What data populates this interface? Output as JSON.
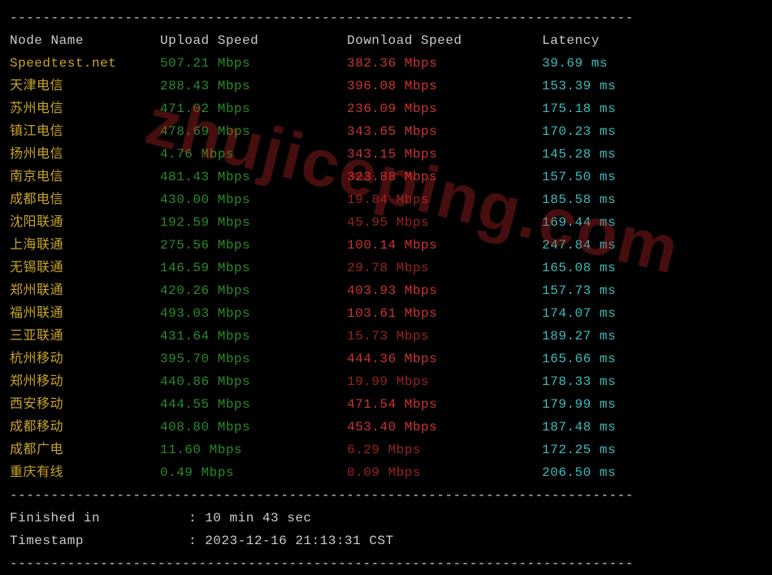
{
  "watermark": "zhujiceping.com",
  "divider": "----------------------------------------------------------------------------",
  "headers": {
    "node": "Node Name",
    "upload": "Upload Speed",
    "download": "Download Speed",
    "latency": "Latency"
  },
  "rows": [
    {
      "node": "Speedtest.net",
      "upload": "507.21 Mbps",
      "download": "382.36 Mbps",
      "latency": "39.69 ms",
      "nodeClass": "yellow",
      "uploadClass": "green",
      "downloadClass": "red",
      "latencyClass": "cyan"
    },
    {
      "node": "天津电信",
      "upload": "288.43 Mbps",
      "download": "396.08 Mbps",
      "latency": "153.39 ms",
      "nodeClass": "yellow",
      "uploadClass": "green",
      "downloadClass": "red",
      "latencyClass": "cyan"
    },
    {
      "node": "苏州电信",
      "upload": "471.02 Mbps",
      "download": "236.09 Mbps",
      "latency": "175.18 ms",
      "nodeClass": "yellow",
      "uploadClass": "green",
      "downloadClass": "red",
      "latencyClass": "cyan"
    },
    {
      "node": "镇江电信",
      "upload": "478.69 Mbps",
      "download": "343.65 Mbps",
      "latency": "170.23 ms",
      "nodeClass": "yellow",
      "uploadClass": "green",
      "downloadClass": "red",
      "latencyClass": "cyan"
    },
    {
      "node": "扬州电信",
      "upload": "4.76 Mbps",
      "download": "343.15 Mbps",
      "latency": "145.28 ms",
      "nodeClass": "yellow",
      "uploadClass": "green",
      "downloadClass": "red",
      "latencyClass": "cyan"
    },
    {
      "node": "南京电信",
      "upload": "481.43 Mbps",
      "download": "323.88 Mbps",
      "latency": "157.50 ms",
      "nodeClass": "yellow",
      "uploadClass": "green",
      "downloadClass": "red",
      "latencyClass": "cyan"
    },
    {
      "node": "成都电信",
      "upload": "430.00 Mbps",
      "download": "19.84 Mbps",
      "latency": "185.58 ms",
      "nodeClass": "yellow",
      "uploadClass": "green",
      "downloadClass": "darkred",
      "latencyClass": "cyan"
    },
    {
      "node": "沈阳联通",
      "upload": "192.59 Mbps",
      "download": "45.95 Mbps",
      "latency": "169.44 ms",
      "nodeClass": "yellow",
      "uploadClass": "green",
      "downloadClass": "darkred",
      "latencyClass": "cyan"
    },
    {
      "node": "上海联通",
      "upload": "275.56 Mbps",
      "download": "100.14 Mbps",
      "latency": "247.84 ms",
      "nodeClass": "yellow",
      "uploadClass": "green",
      "downloadClass": "red",
      "latencyClass": "cyan"
    },
    {
      "node": "无锡联通",
      "upload": "146.59 Mbps",
      "download": "29.78 Mbps",
      "latency": "165.08 ms",
      "nodeClass": "yellow",
      "uploadClass": "green",
      "downloadClass": "darkred",
      "latencyClass": "cyan"
    },
    {
      "node": "郑州联通",
      "upload": "420.26 Mbps",
      "download": "403.93 Mbps",
      "latency": "157.73 ms",
      "nodeClass": "yellow",
      "uploadClass": "green",
      "downloadClass": "red",
      "latencyClass": "cyan"
    },
    {
      "node": "福州联通",
      "upload": "493.03 Mbps",
      "download": "103.61 Mbps",
      "latency": "174.07 ms",
      "nodeClass": "yellow",
      "uploadClass": "green",
      "downloadClass": "red",
      "latencyClass": "cyan"
    },
    {
      "node": "三亚联通",
      "upload": "431.64 Mbps",
      "download": "15.73 Mbps",
      "latency": "189.27 ms",
      "nodeClass": "yellow",
      "uploadClass": "green",
      "downloadClass": "darkred",
      "latencyClass": "cyan"
    },
    {
      "node": "杭州移动",
      "upload": "395.70 Mbps",
      "download": "444.36 Mbps",
      "latency": "165.66 ms",
      "nodeClass": "yellow",
      "uploadClass": "green",
      "downloadClass": "red",
      "latencyClass": "cyan"
    },
    {
      "node": "郑州移动",
      "upload": "440.86 Mbps",
      "download": "19.99 Mbps",
      "latency": "178.33 ms",
      "nodeClass": "yellow",
      "uploadClass": "green",
      "downloadClass": "darkred",
      "latencyClass": "cyan"
    },
    {
      "node": "西安移动",
      "upload": "444.55 Mbps",
      "download": "471.54 Mbps",
      "latency": "179.99 ms",
      "nodeClass": "yellow",
      "uploadClass": "green",
      "downloadClass": "red",
      "latencyClass": "cyan"
    },
    {
      "node": "成都移动",
      "upload": "408.80 Mbps",
      "download": "453.40 Mbps",
      "latency": "187.48 ms",
      "nodeClass": "yellow",
      "uploadClass": "green",
      "downloadClass": "red",
      "latencyClass": "cyan"
    },
    {
      "node": "成都广电",
      "upload": "11.60 Mbps",
      "download": "6.29 Mbps",
      "latency": "172.25 ms",
      "nodeClass": "yellow",
      "uploadClass": "green",
      "downloadClass": "darkred",
      "latencyClass": "cyan"
    },
    {
      "node": "重庆有线",
      "upload": "0.49 Mbps",
      "download": "0.09 Mbps",
      "latency": "206.50 ms",
      "nodeClass": "yellow",
      "uploadClass": "green",
      "downloadClass": "darkred",
      "latencyClass": "cyan"
    }
  ],
  "footer": {
    "finished_label": "Finished in",
    "finished_sep": ": ",
    "finished_value": "10 min 43 sec",
    "timestamp_label": "Timestamp",
    "timestamp_sep": ": ",
    "timestamp_value": "2023-12-16 21:13:31 CST"
  }
}
